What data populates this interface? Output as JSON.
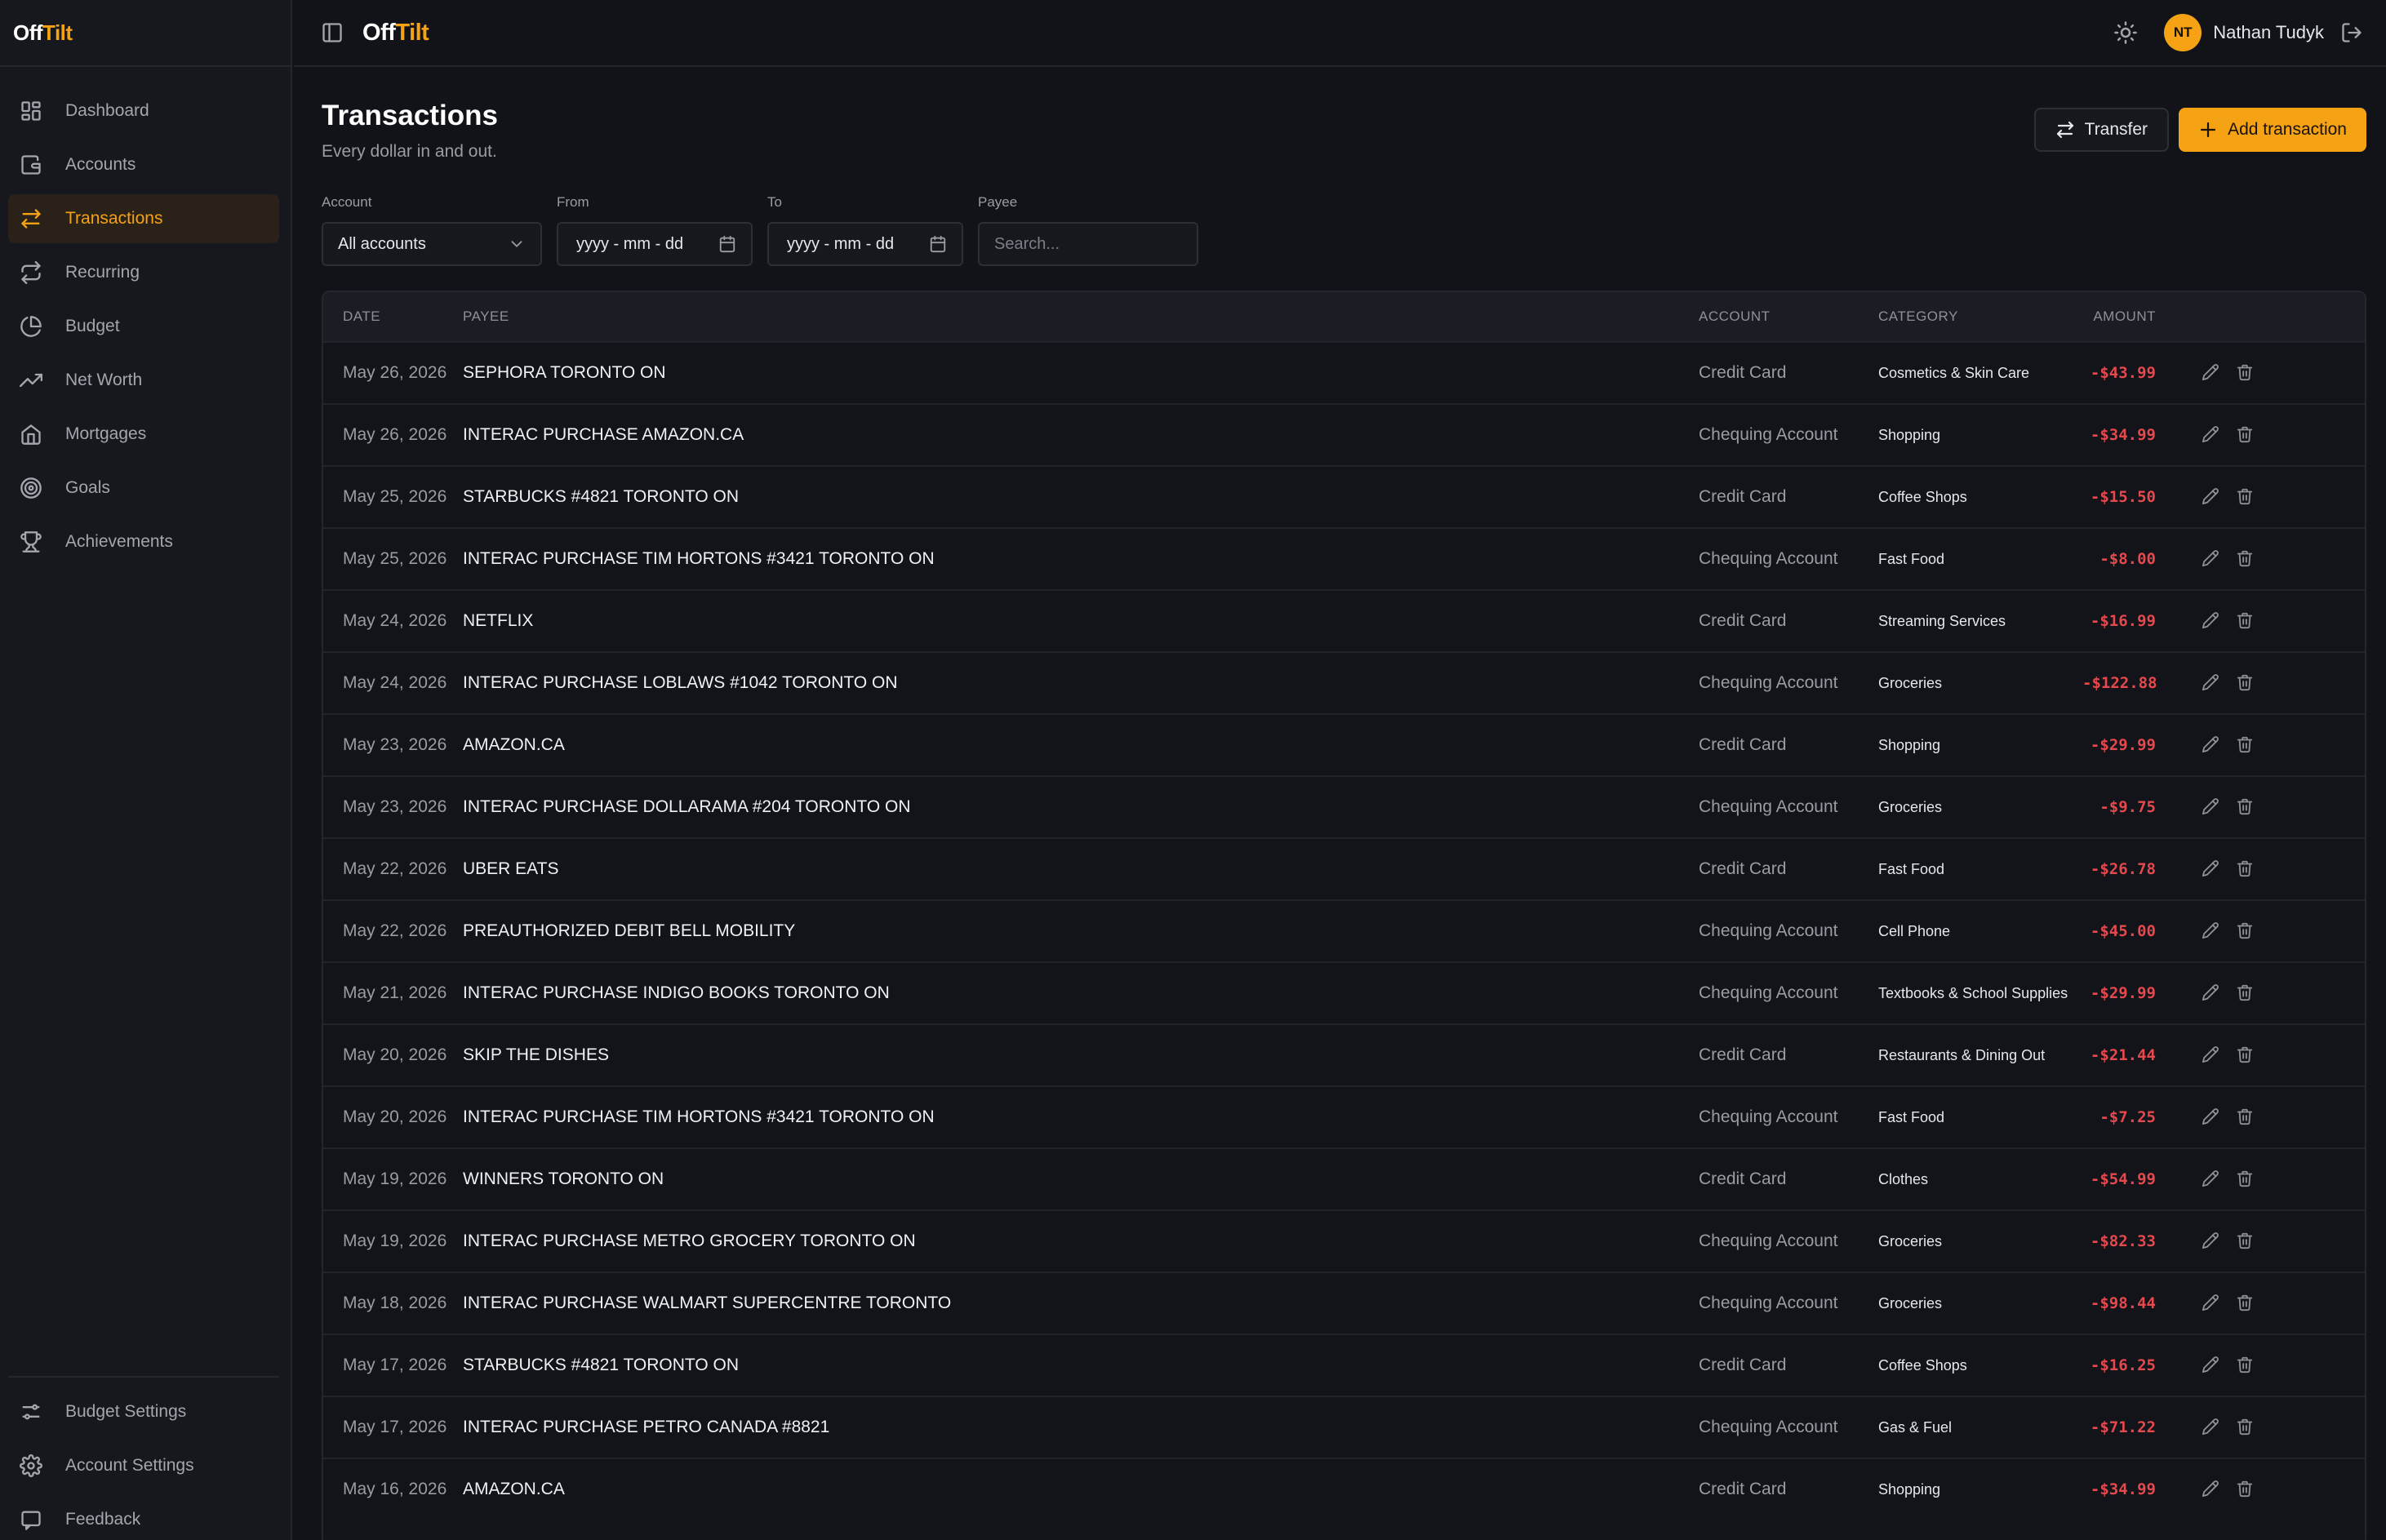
{
  "app": {
    "logo_main": "Off",
    "logo_accent": "Tilt"
  },
  "sidebar": {
    "items": [
      {
        "label": "Dashboard",
        "icon": "dashboard-icon",
        "active": false
      },
      {
        "label": "Accounts",
        "icon": "wallet-icon",
        "active": false
      },
      {
        "label": "Transactions",
        "icon": "arrows-swap-icon",
        "active": true
      },
      {
        "label": "Recurring",
        "icon": "repeat-icon",
        "active": false
      },
      {
        "label": "Budget",
        "icon": "pie-chart-icon",
        "active": false
      },
      {
        "label": "Net Worth",
        "icon": "trending-up-icon",
        "active": false
      },
      {
        "label": "Mortgages",
        "icon": "home-icon",
        "active": false
      },
      {
        "label": "Goals",
        "icon": "target-icon",
        "active": false
      },
      {
        "label": "Achievements",
        "icon": "trophy-icon",
        "active": false
      }
    ],
    "bottom_items": [
      {
        "label": "Budget Settings",
        "icon": "sliders-icon"
      },
      {
        "label": "Account Settings",
        "icon": "gear-icon"
      },
      {
        "label": "Feedback",
        "icon": "message-icon"
      }
    ]
  },
  "topbar": {
    "user_initials": "NT",
    "user_name": "Nathan Tudyk"
  },
  "page": {
    "title": "Transactions",
    "subtitle": "Every dollar in and out.",
    "transfer_label": "Transfer",
    "add_label": "Add transaction"
  },
  "filters": {
    "account_label": "Account",
    "account_value": "All accounts",
    "from_label": "From",
    "from_placeholder": "yyyy - mm - dd",
    "to_label": "To",
    "to_placeholder": "yyyy - mm - dd",
    "payee_label": "Payee",
    "payee_placeholder": "Search..."
  },
  "table": {
    "headers": {
      "date": "DATE",
      "payee": "PAYEE",
      "account": "ACCOUNT",
      "category": "CATEGORY",
      "amount": "AMOUNT"
    },
    "rows": [
      {
        "date": "May 26, 2026",
        "payee": "SEPHORA TORONTO ON",
        "account": "Credit Card",
        "category": "Cosmetics & Skin Care",
        "amount": "-$43.99"
      },
      {
        "date": "May 26, 2026",
        "payee": "INTERAC PURCHASE AMAZON.CA",
        "account": "Chequing Account",
        "category": "Shopping",
        "amount": "-$34.99"
      },
      {
        "date": "May 25, 2026",
        "payee": "STARBUCKS #4821 TORONTO ON",
        "account": "Credit Card",
        "category": "Coffee Shops",
        "amount": "-$15.50"
      },
      {
        "date": "May 25, 2026",
        "payee": "INTERAC PURCHASE TIM HORTONS #3421 TORONTO ON",
        "account": "Chequing Account",
        "category": "Fast Food",
        "amount": "-$8.00"
      },
      {
        "date": "May 24, 2026",
        "payee": "NETFLIX",
        "account": "Credit Card",
        "category": "Streaming Services",
        "amount": "-$16.99"
      },
      {
        "date": "May 24, 2026",
        "payee": "INTERAC PURCHASE LOBLAWS #1042 TORONTO ON",
        "account": "Chequing Account",
        "category": "Groceries",
        "amount": "-$122.88"
      },
      {
        "date": "May 23, 2026",
        "payee": "AMAZON.CA",
        "account": "Credit Card",
        "category": "Shopping",
        "amount": "-$29.99"
      },
      {
        "date": "May 23, 2026",
        "payee": "INTERAC PURCHASE DOLLARAMA #204 TORONTO ON",
        "account": "Chequing Account",
        "category": "Groceries",
        "amount": "-$9.75"
      },
      {
        "date": "May 22, 2026",
        "payee": "UBER EATS",
        "account": "Credit Card",
        "category": "Fast Food",
        "amount": "-$26.78"
      },
      {
        "date": "May 22, 2026",
        "payee": "PREAUTHORIZED DEBIT BELL MOBILITY",
        "account": "Chequing Account",
        "category": "Cell Phone",
        "amount": "-$45.00"
      },
      {
        "date": "May 21, 2026",
        "payee": "INTERAC PURCHASE INDIGO BOOKS TORONTO ON",
        "account": "Chequing Account",
        "category": "Textbooks & School Supplies",
        "amount": "-$29.99"
      },
      {
        "date": "May 20, 2026",
        "payee": "SKIP THE DISHES",
        "account": "Credit Card",
        "category": "Restaurants & Dining Out",
        "amount": "-$21.44"
      },
      {
        "date": "May 20, 2026",
        "payee": "INTERAC PURCHASE TIM HORTONS #3421 TORONTO ON",
        "account": "Chequing Account",
        "category": "Fast Food",
        "amount": "-$7.25"
      },
      {
        "date": "May 19, 2026",
        "payee": "WINNERS TORONTO ON",
        "account": "Credit Card",
        "category": "Clothes",
        "amount": "-$54.99"
      },
      {
        "date": "May 19, 2026",
        "payee": "INTERAC PURCHASE METRO GROCERY TORONTO ON",
        "account": "Chequing Account",
        "category": "Groceries",
        "amount": "-$82.33"
      },
      {
        "date": "May 18, 2026",
        "payee": "INTERAC PURCHASE WALMART SUPERCENTRE TORONTO",
        "account": "Chequing Account",
        "category": "Groceries",
        "amount": "-$98.44"
      },
      {
        "date": "May 17, 2026",
        "payee": "STARBUCKS #4821 TORONTO ON",
        "account": "Credit Card",
        "category": "Coffee Shops",
        "amount": "-$16.25"
      },
      {
        "date": "May 17, 2026",
        "payee": "INTERAC PURCHASE PETRO CANADA #8821",
        "account": "Chequing Account",
        "category": "Gas & Fuel",
        "amount": "-$71.22"
      },
      {
        "date": "May 16, 2026",
        "payee": "AMAZON.CA",
        "account": "Credit Card",
        "category": "Shopping",
        "amount": "-$34.99"
      }
    ]
  },
  "colors": {
    "accent": "#f5a215",
    "background": "#121318",
    "negative_amount": "#e5484d"
  }
}
